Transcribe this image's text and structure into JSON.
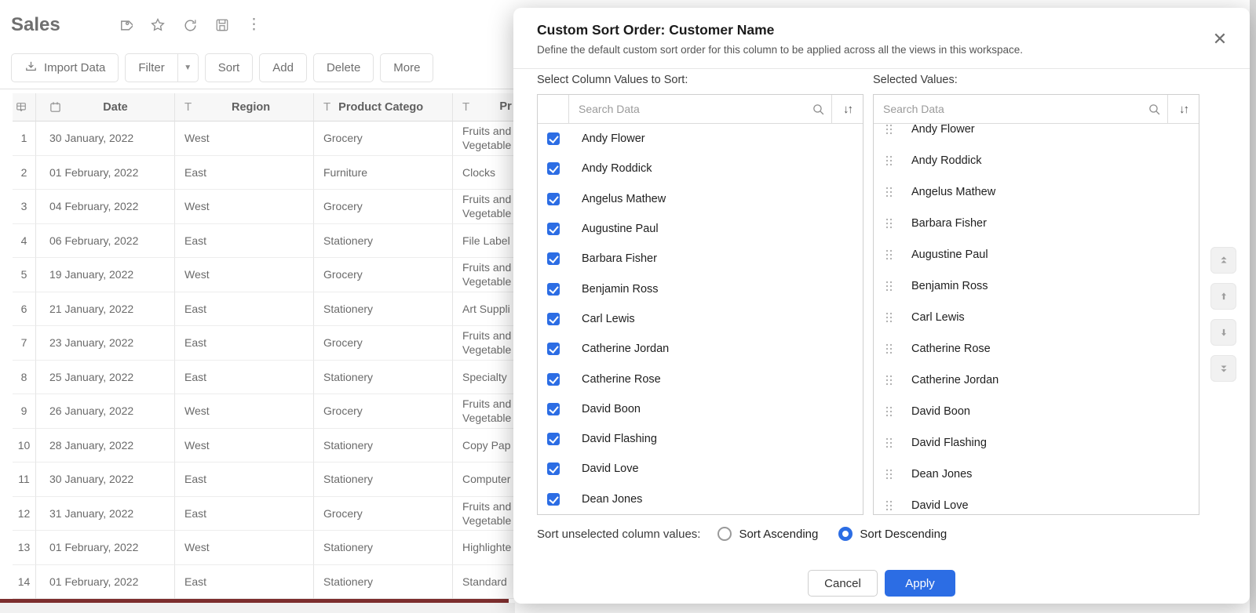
{
  "app": {
    "title": "Sales"
  },
  "toolbar": {
    "import": "Import Data",
    "filter": "Filter",
    "sort": "Sort",
    "add": "Add",
    "delete": "Delete",
    "more": "More"
  },
  "table": {
    "header": {
      "date": "Date",
      "region": "Region",
      "category": "Product Catego",
      "product": "Pr"
    },
    "rows": [
      {
        "n": "1",
        "date": "30 January, 2022",
        "region": "West",
        "category": "Grocery",
        "product": "Fruits and Vegetable"
      },
      {
        "n": "2",
        "date": "01 February, 2022",
        "region": "East",
        "category": "Furniture",
        "product": "Clocks"
      },
      {
        "n": "3",
        "date": "04 February, 2022",
        "region": "West",
        "category": "Grocery",
        "product": "Fruits and Vegetable"
      },
      {
        "n": "4",
        "date": "06 February, 2022",
        "region": "East",
        "category": "Stationery",
        "product": "File Label"
      },
      {
        "n": "5",
        "date": "19 January, 2022",
        "region": "West",
        "category": "Grocery",
        "product": "Fruits and Vegetable"
      },
      {
        "n": "6",
        "date": "21 January, 2022",
        "region": "East",
        "category": "Stationery",
        "product": "Art Suppli"
      },
      {
        "n": "7",
        "date": "23 January, 2022",
        "region": "East",
        "category": "Grocery",
        "product": "Fruits and Vegetable"
      },
      {
        "n": "8",
        "date": "25 January, 2022",
        "region": "East",
        "category": "Stationery",
        "product": "Specialty"
      },
      {
        "n": "9",
        "date": "26 January, 2022",
        "region": "West",
        "category": "Grocery",
        "product": "Fruits and Vegetable"
      },
      {
        "n": "10",
        "date": "28 January, 2022",
        "region": "West",
        "category": "Stationery",
        "product": "Copy Pap"
      },
      {
        "n": "11",
        "date": "30 January, 2022",
        "region": "East",
        "category": "Stationery",
        "product": "Computer"
      },
      {
        "n": "12",
        "date": "31 January, 2022",
        "region": "East",
        "category": "Grocery",
        "product": "Fruits and Vegetable"
      },
      {
        "n": "13",
        "date": "01 February, 2022",
        "region": "West",
        "category": "Stationery",
        "product": "Highlighte"
      },
      {
        "n": "14",
        "date": "01 February, 2022",
        "region": "East",
        "category": "Stationery",
        "product": "Standard"
      }
    ]
  },
  "dialog": {
    "title": "Custom Sort Order: Customer Name",
    "subtitle": "Define the default custom sort order for this column to be applied across all the views in this workspace.",
    "close": "✕",
    "left_panel": {
      "label": "Select Column Values to Sort:",
      "search_placeholder": "Search Data",
      "items": [
        {
          "name": "Andy Flower"
        },
        {
          "name": "Andy Roddick"
        },
        {
          "name": "Angelus Mathew"
        },
        {
          "name": "Augustine Paul"
        },
        {
          "name": "Barbara Fisher"
        },
        {
          "name": "Benjamin Ross"
        },
        {
          "name": "Carl Lewis"
        },
        {
          "name": "Catherine Jordan"
        },
        {
          "name": "Catherine Rose"
        },
        {
          "name": "David Boon"
        },
        {
          "name": "David Flashing"
        },
        {
          "name": "David Love"
        },
        {
          "name": "Dean Jones"
        }
      ]
    },
    "right_panel": {
      "label": "Selected Values:",
      "search_placeholder": "Search Data",
      "items": [
        {
          "name": "Andy Flower"
        },
        {
          "name": "Andy Roddick"
        },
        {
          "name": "Angelus Mathew"
        },
        {
          "name": "Barbara Fisher"
        },
        {
          "name": "Augustine Paul"
        },
        {
          "name": "Benjamin Ross"
        },
        {
          "name": "Carl Lewis"
        },
        {
          "name": "Catherine Rose"
        },
        {
          "name": "Catherine Jordan"
        },
        {
          "name": "David Boon"
        },
        {
          "name": "David Flashing"
        },
        {
          "name": "Dean Jones"
        },
        {
          "name": "David Love"
        }
      ]
    },
    "sort_options": {
      "label": "Sort unselected column values:",
      "ascending": "Sort Ascending",
      "descending": "Sort Descending",
      "selected": "Sort Descending"
    },
    "actions": {
      "cancel": "Cancel",
      "apply": "Apply"
    }
  },
  "colors": {
    "accent": "#2c6de4",
    "maroon_bar": "#7d2f2f"
  }
}
